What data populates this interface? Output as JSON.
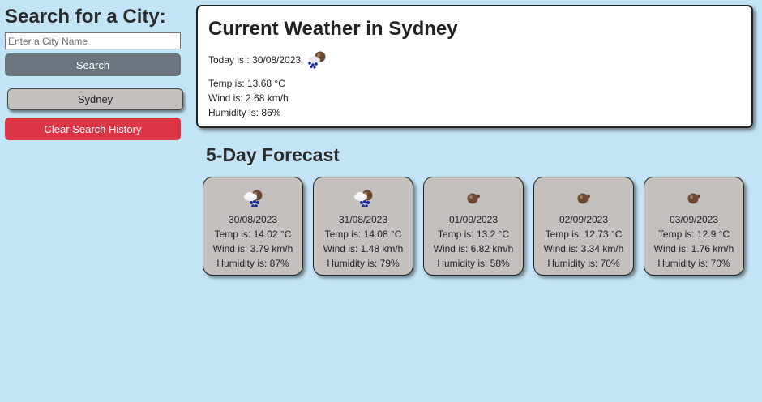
{
  "sidebar": {
    "title": "Search for a City:",
    "search_placeholder": "Enter a City Name",
    "search_value": "",
    "search_button": "Search",
    "history": [
      "Sydney"
    ],
    "clear_button": "Clear Search History"
  },
  "current": {
    "title": "Current Weather in Sydney",
    "today": "Today is : 30/08/2023",
    "icon": "rain-cloud-icon",
    "temp": "Temp is: 13.68 °C",
    "wind": "Wind is: 2.68 km/h",
    "humidity": "Humidity is: 86%"
  },
  "forecast": {
    "title": "5-Day Forecast",
    "days": [
      {
        "date": "30/08/2023",
        "temp": "Temp is: 14.02 °C",
        "wind": "Wind is: 3.79 km/h",
        "humidity": "Humidity is: 87%",
        "icon": "rain-cloud-icon"
      },
      {
        "date": "31/08/2023",
        "temp": "Temp is: 14.08 °C",
        "wind": "Wind is: 1.48 km/h",
        "humidity": "Humidity is: 79%",
        "icon": "rain-cloud-icon"
      },
      {
        "date": "01/09/2023",
        "temp": "Temp is: 13.2 °C",
        "wind": "Wind is: 6.82 km/h",
        "humidity": "Humidity is: 58%",
        "icon": "cloud-icon"
      },
      {
        "date": "02/09/2023",
        "temp": "Temp is: 12.73 °C",
        "wind": "Wind is: 3.34 km/h",
        "humidity": "Humidity is: 70%",
        "icon": "cloud-icon"
      },
      {
        "date": "03/09/2023",
        "temp": "Temp is: 12.9 °C",
        "wind": "Wind is: 1.76 km/h",
        "humidity": "Humidity is: 70%",
        "icon": "cloud-icon"
      }
    ]
  },
  "colors": {
    "background": "#c3e3f7",
    "search_button": "#6c757d",
    "clear_button": "#dc3545",
    "card": "#c3c0bd"
  }
}
